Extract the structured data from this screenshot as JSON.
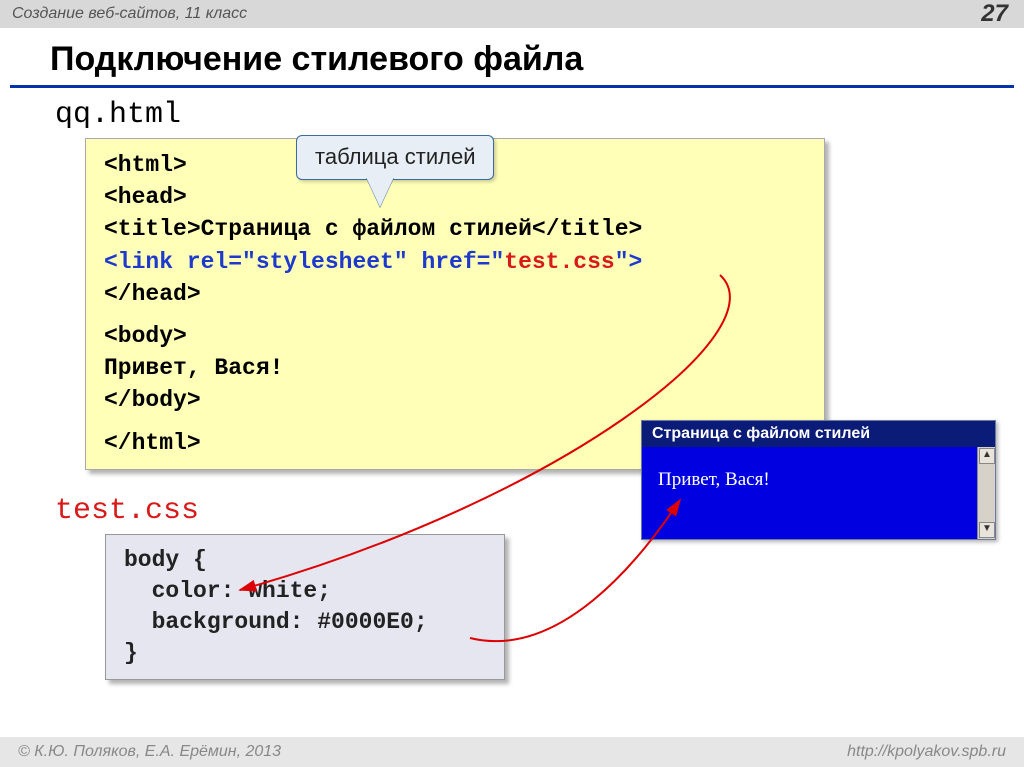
{
  "header": {
    "course": "Создание веб-сайтов, 11 класс",
    "page_number": "27"
  },
  "title": "Подключение стилевого файла",
  "html_file": {
    "name": "qq.html",
    "callout": "таблица стилей",
    "lines": {
      "l1": "<html>",
      "l2": "<head>",
      "l3a": "<title>",
      "l3b": "Страница с файлом стилей",
      "l3c": "</title>",
      "l4a": "<link rel=\"stylesheet\" href=\"",
      "l4b": "test.css",
      "l4c": "\">",
      "l5": "</head>",
      "l6": "<body>",
      "l7": "Привет, Вася!",
      "l8": "</body>",
      "l9": "</html>"
    }
  },
  "css_file": {
    "name": "test.css",
    "code": {
      "l1": "body {",
      "l2": "  color: white;",
      "l3": "  background: #0000E0;",
      "l4": "}"
    }
  },
  "browser": {
    "title": "Страница с файлом стилей",
    "body_text": "Привет, Вася!",
    "scroll_up": "▲",
    "scroll_down": "▼"
  },
  "footer": {
    "copyright": "© К.Ю. Поляков, Е.А. Ерёмин, 2013",
    "url": "http://kpolyakov.spb.ru"
  }
}
